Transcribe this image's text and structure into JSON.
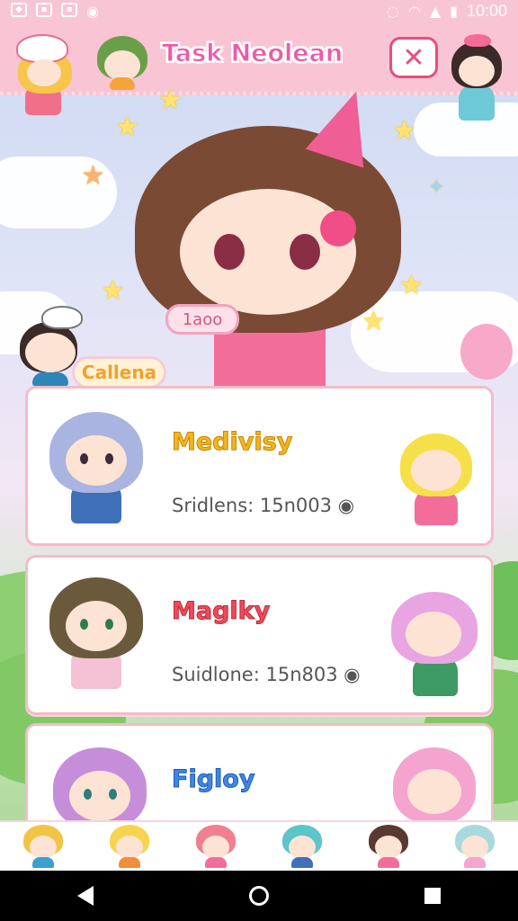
{
  "status": {
    "time": "10:00"
  },
  "header": {
    "title": "Task Neolean",
    "close_icon": "close-icon"
  },
  "hero": {
    "badge": "1aoo"
  },
  "section": {
    "label": "Callena"
  },
  "tasks": [
    {
      "name": "Medivisy",
      "meta": "Sridlens: 15n003",
      "name_color": "#f2b61b"
    },
    {
      "name": "Maglky",
      "meta": "Suidlone: 15n803",
      "name_color": "#ef4a5a"
    },
    {
      "name": "Figloy",
      "meta": "",
      "name_color": "#3f86e6"
    }
  ],
  "colors": {
    "pink": "#f9c4d3",
    "accent": "#ee5aa5",
    "card_border": "#f3bcc7"
  }
}
